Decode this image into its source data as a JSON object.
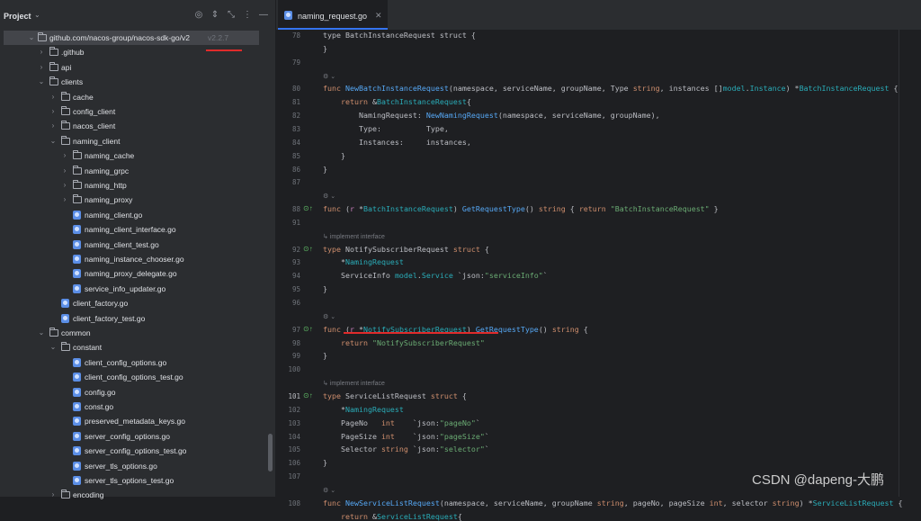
{
  "sidebar": {
    "title": "Project",
    "tree": [
      {
        "label": "github.com/nacos-group/nacos-sdk-go/v2",
        "version": "v2.2.7",
        "depth": 0,
        "kind": "folder",
        "expanded": true,
        "selected": true
      },
      {
        "label": ".github",
        "depth": 1,
        "kind": "folder",
        "expanded": false
      },
      {
        "label": "api",
        "depth": 1,
        "kind": "folder",
        "expanded": false
      },
      {
        "label": "clients",
        "depth": 1,
        "kind": "folder",
        "expanded": true
      },
      {
        "label": "cache",
        "depth": 2,
        "kind": "folder",
        "expanded": false
      },
      {
        "label": "config_client",
        "depth": 2,
        "kind": "folder",
        "expanded": false
      },
      {
        "label": "nacos_client",
        "depth": 2,
        "kind": "folder",
        "expanded": false
      },
      {
        "label": "naming_client",
        "depth": 2,
        "kind": "folder",
        "expanded": true
      },
      {
        "label": "naming_cache",
        "depth": 3,
        "kind": "folder",
        "expanded": false
      },
      {
        "label": "naming_grpc",
        "depth": 3,
        "kind": "folder",
        "expanded": false
      },
      {
        "label": "naming_http",
        "depth": 3,
        "kind": "folder",
        "expanded": false
      },
      {
        "label": "naming_proxy",
        "depth": 3,
        "kind": "folder",
        "expanded": false
      },
      {
        "label": "naming_client.go",
        "depth": 3,
        "kind": "file"
      },
      {
        "label": "naming_client_interface.go",
        "depth": 3,
        "kind": "file"
      },
      {
        "label": "naming_client_test.go",
        "depth": 3,
        "kind": "file"
      },
      {
        "label": "naming_instance_chooser.go",
        "depth": 3,
        "kind": "file"
      },
      {
        "label": "naming_proxy_delegate.go",
        "depth": 3,
        "kind": "file"
      },
      {
        "label": "service_info_updater.go",
        "depth": 3,
        "kind": "file"
      },
      {
        "label": "client_factory.go",
        "depth": 2,
        "kind": "file"
      },
      {
        "label": "client_factory_test.go",
        "depth": 2,
        "kind": "file"
      },
      {
        "label": "common",
        "depth": 1,
        "kind": "folder",
        "expanded": true
      },
      {
        "label": "constant",
        "depth": 2,
        "kind": "folder",
        "expanded": true
      },
      {
        "label": "client_config_options.go",
        "depth": 3,
        "kind": "file"
      },
      {
        "label": "client_config_options_test.go",
        "depth": 3,
        "kind": "file"
      },
      {
        "label": "config.go",
        "depth": 3,
        "kind": "file"
      },
      {
        "label": "const.go",
        "depth": 3,
        "kind": "file"
      },
      {
        "label": "preserved_metadata_keys.go",
        "depth": 3,
        "kind": "file"
      },
      {
        "label": "server_config_options.go",
        "depth": 3,
        "kind": "file"
      },
      {
        "label": "server_config_options_test.go",
        "depth": 3,
        "kind": "file"
      },
      {
        "label": "server_tls_options.go",
        "depth": 3,
        "kind": "file"
      },
      {
        "label": "server_tls_options_test.go",
        "depth": 3,
        "kind": "file"
      },
      {
        "label": "encoding",
        "depth": 2,
        "kind": "folder",
        "expanded": false
      }
    ]
  },
  "editor": {
    "tab_title": "naming_request.go",
    "current_line": 101,
    "lines": [
      {
        "n": "78",
        "tokens": [
          {
            "t": "type BatchInstanceRequest struct {"
          }
        ]
      },
      {
        "n": "",
        "tokens": [
          {
            "t": "}"
          }
        ]
      },
      {
        "n": "79",
        "tokens": []
      },
      {
        "n": "",
        "hint": "⚙ ⌄"
      },
      {
        "n": "80",
        "tokens": [
          {
            "t": "func ",
            "c": "kw"
          },
          {
            "t": "NewBatchInstanceRequest",
            "c": "fn"
          },
          {
            "t": "(namespace, serviceName, groupName, Type "
          },
          {
            "t": "string",
            "c": "kw"
          },
          {
            "t": ", instances []"
          },
          {
            "t": "model",
            "c": "ty"
          },
          {
            "t": "."
          },
          {
            "t": "Instance",
            "c": "ty"
          },
          {
            "t": ") *"
          },
          {
            "t": "BatchInstanceRequest",
            "c": "ty"
          },
          {
            "t": " {"
          }
        ]
      },
      {
        "n": "81",
        "tokens": [
          {
            "t": "    "
          },
          {
            "t": "return ",
            "c": "kw"
          },
          {
            "t": "&"
          },
          {
            "t": "BatchInstanceRequest",
            "c": "ty"
          },
          {
            "t": "{"
          }
        ]
      },
      {
        "n": "82",
        "tokens": [
          {
            "t": "        NamingRequest: "
          },
          {
            "t": "NewNamingRequest",
            "c": "fn"
          },
          {
            "t": "(namespace, serviceName, groupName),"
          }
        ]
      },
      {
        "n": "83",
        "tokens": [
          {
            "t": "        Type:          Type,"
          }
        ]
      },
      {
        "n": "84",
        "tokens": [
          {
            "t": "        Instances:     instances,"
          }
        ]
      },
      {
        "n": "85",
        "tokens": [
          {
            "t": "    }"
          }
        ]
      },
      {
        "n": "86",
        "tokens": [
          {
            "t": "}"
          }
        ]
      },
      {
        "n": "87",
        "tokens": []
      },
      {
        "n": "",
        "hint": "⚙ ⌄"
      },
      {
        "n": "88",
        "gi": "⊙↑",
        "tokens": [
          {
            "t": "func ",
            "c": "kw"
          },
          {
            "t": "("
          },
          {
            "t": "r",
            "c": "pm"
          },
          {
            "t": " *"
          },
          {
            "t": "BatchInstanceRequest",
            "c": "ty"
          },
          {
            "t": ") "
          },
          {
            "t": "GetRequestType",
            "c": "fn"
          },
          {
            "t": "() "
          },
          {
            "t": "string",
            "c": "kw"
          },
          {
            "t": " { "
          },
          {
            "t": "return ",
            "c": "kw"
          },
          {
            "t": "\"BatchInstanceRequest\"",
            "c": "st"
          },
          {
            "t": " }"
          }
        ]
      },
      {
        "n": "91",
        "tokens": []
      },
      {
        "n": "",
        "hint": "↳ implement interface"
      },
      {
        "n": "92",
        "gi": "⊙↑",
        "tokens": [
          {
            "t": "type ",
            "c": "kw"
          },
          {
            "t": "NotifySubscriberRequest "
          },
          {
            "t": "struct",
            "c": "kw"
          },
          {
            "t": " {"
          }
        ]
      },
      {
        "n": "93",
        "tokens": [
          {
            "t": "    *"
          },
          {
            "t": "NamingRequest",
            "c": "ty"
          }
        ]
      },
      {
        "n": "94",
        "tokens": [
          {
            "t": "    ServiceInfo "
          },
          {
            "t": "model",
            "c": "ty"
          },
          {
            "t": "."
          },
          {
            "t": "Service",
            "c": "ty"
          },
          {
            "t": " `json:"
          },
          {
            "t": "\"serviceInfo\"",
            "c": "st"
          },
          {
            "t": "`"
          }
        ]
      },
      {
        "n": "95",
        "tokens": [
          {
            "t": "}"
          }
        ]
      },
      {
        "n": "96",
        "tokens": []
      },
      {
        "n": "",
        "hint": "⚙ ⌄"
      },
      {
        "n": "97",
        "gi": "⊙↑",
        "tokens": [
          {
            "t": "func ",
            "c": "kw"
          },
          {
            "t": "("
          },
          {
            "t": "r",
            "c": "pm"
          },
          {
            "t": " *"
          },
          {
            "t": "NotifySubscriberRequest",
            "c": "ty"
          },
          {
            "t": ") "
          },
          {
            "t": "GetRequestType",
            "c": "fn"
          },
          {
            "t": "() "
          },
          {
            "t": "string",
            "c": "kw"
          },
          {
            "t": " {"
          }
        ]
      },
      {
        "n": "98",
        "tokens": [
          {
            "t": "    "
          },
          {
            "t": "return ",
            "c": "kw"
          },
          {
            "t": "\"NotifySubscriberRequest\"",
            "c": "st"
          }
        ]
      },
      {
        "n": "99",
        "tokens": [
          {
            "t": "}"
          }
        ]
      },
      {
        "n": "100",
        "tokens": []
      },
      {
        "n": "",
        "hint": "↳ implement interface"
      },
      {
        "n": "101",
        "gi": "⊙↑",
        "tokens": [
          {
            "t": "type ",
            "c": "kw"
          },
          {
            "t": "ServiceListRequest "
          },
          {
            "t": "struct",
            "c": "kw"
          },
          {
            "t": " {"
          }
        ]
      },
      {
        "n": "102",
        "tokens": [
          {
            "t": "    *"
          },
          {
            "t": "NamingRequest",
            "c": "ty"
          }
        ]
      },
      {
        "n": "103",
        "tokens": [
          {
            "t": "    PageNo   "
          },
          {
            "t": "int",
            "c": "kw"
          },
          {
            "t": "    `json:"
          },
          {
            "t": "\"pageNo\"",
            "c": "st"
          },
          {
            "t": "`"
          }
        ]
      },
      {
        "n": "104",
        "tokens": [
          {
            "t": "    PageSize "
          },
          {
            "t": "int",
            "c": "kw"
          },
          {
            "t": "    `json:"
          },
          {
            "t": "\"pageSize\"",
            "c": "st"
          },
          {
            "t": "`"
          }
        ]
      },
      {
        "n": "105",
        "tokens": [
          {
            "t": "    Selector "
          },
          {
            "t": "string",
            "c": "kw"
          },
          {
            "t": " `json:"
          },
          {
            "t": "\"selector\"",
            "c": "st"
          },
          {
            "t": "`"
          }
        ]
      },
      {
        "n": "106",
        "tokens": [
          {
            "t": "}"
          }
        ]
      },
      {
        "n": "107",
        "tokens": []
      },
      {
        "n": "",
        "hint": "⚙ ⌄"
      },
      {
        "n": "108",
        "tokens": [
          {
            "t": "func ",
            "c": "kw"
          },
          {
            "t": "NewServiceListRequest",
            "c": "fn"
          },
          {
            "t": "(namespace, serviceName, groupName "
          },
          {
            "t": "string",
            "c": "kw"
          },
          {
            "t": ", pageNo, pageSize "
          },
          {
            "t": "int",
            "c": "kw"
          },
          {
            "t": ", selector "
          },
          {
            "t": "string",
            "c": "kw"
          },
          {
            "t": ") *"
          },
          {
            "t": "ServiceListRequest",
            "c": "ty"
          },
          {
            "t": " {"
          }
        ]
      },
      {
        "n": "",
        "tokens": [
          {
            "t": "    "
          },
          {
            "t": "return ",
            "c": "kw"
          },
          {
            "t": "&"
          },
          {
            "t": "ServiceListRequest",
            "c": "ty"
          },
          {
            "t": "{"
          }
        ]
      }
    ]
  },
  "watermark": "CSDN @dapeng-大鹏",
  "colors": {
    "accent": "#3574f0",
    "annotation_red": "#e02b2b"
  }
}
